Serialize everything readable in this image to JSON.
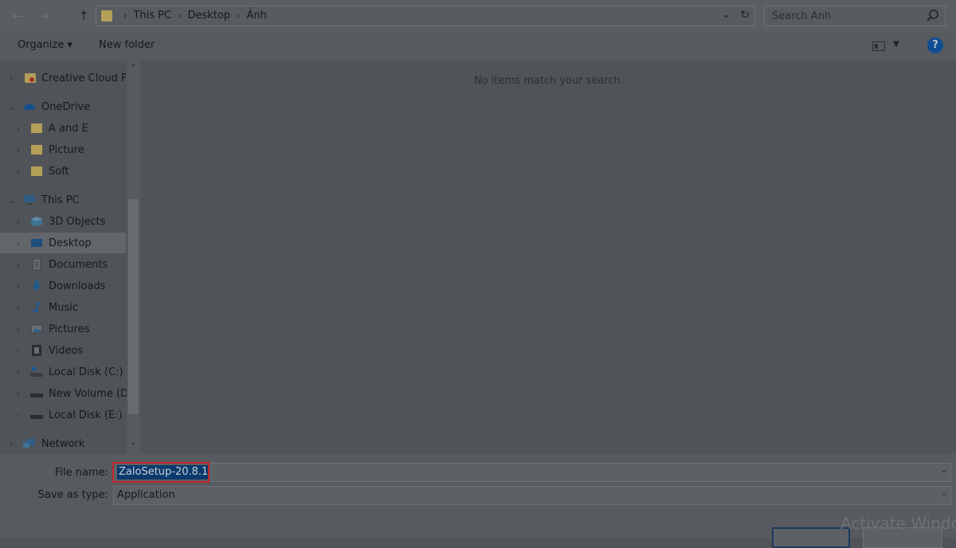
{
  "address": {
    "crumbs": [
      "This PC",
      "Desktop",
      "Ảnh"
    ],
    "back_icon": "arrow-left-icon",
    "forward_icon": "arrow-right-icon",
    "up_icon": "arrow-up-icon"
  },
  "search": {
    "placeholder": "Search Ảnh"
  },
  "toolbar": {
    "organize_label": "Organize ▾",
    "new_folder_label": "New folder",
    "help_label": "?"
  },
  "nav": {
    "items": [
      {
        "label": "Creative Cloud Fil",
        "icon": "creative-cloud-icon",
        "expander": "›"
      },
      {
        "label": "OneDrive",
        "icon": "onedrive-cloud-icon",
        "expander": "⌄"
      },
      {
        "label": "A and E",
        "icon": "folder-icon",
        "expander": "›"
      },
      {
        "label": "Picture",
        "icon": "folder-icon",
        "expander": "›"
      },
      {
        "label": "Soft",
        "icon": "folder-icon",
        "expander": "›"
      },
      {
        "label": "This PC",
        "icon": "computer-icon",
        "expander": "⌄"
      },
      {
        "label": "3D Objects",
        "icon": "cube-icon",
        "expander": "›"
      },
      {
        "label": "Desktop",
        "icon": "desktop-icon",
        "expander": "›"
      },
      {
        "label": "Documents",
        "icon": "document-icon",
        "expander": "›"
      },
      {
        "label": "Downloads",
        "icon": "download-arrow-icon",
        "expander": "›"
      },
      {
        "label": "Music",
        "icon": "music-note-icon",
        "expander": "›"
      },
      {
        "label": "Pictures",
        "icon": "pictures-icon",
        "expander": "›"
      },
      {
        "label": "Videos",
        "icon": "film-icon",
        "expander": "›"
      },
      {
        "label": "Local Disk (C:)",
        "icon": "system-drive-icon",
        "expander": "›"
      },
      {
        "label": "New Volume (D:",
        "icon": "drive-icon",
        "expander": "›"
      },
      {
        "label": "Local Disk (E:)",
        "icon": "drive-icon",
        "expander": "›"
      },
      {
        "label": "Network",
        "icon": "network-icon",
        "expander": "›"
      }
    ],
    "selected": "Desktop"
  },
  "content": {
    "empty_message": "No items match your search."
  },
  "form": {
    "file_name_label": "File name:",
    "file_name_value": "ZaloSetup-20.8.1",
    "save_type_label": "Save as type:",
    "save_type_value": "Application"
  },
  "watermark": "Activate Windo"
}
